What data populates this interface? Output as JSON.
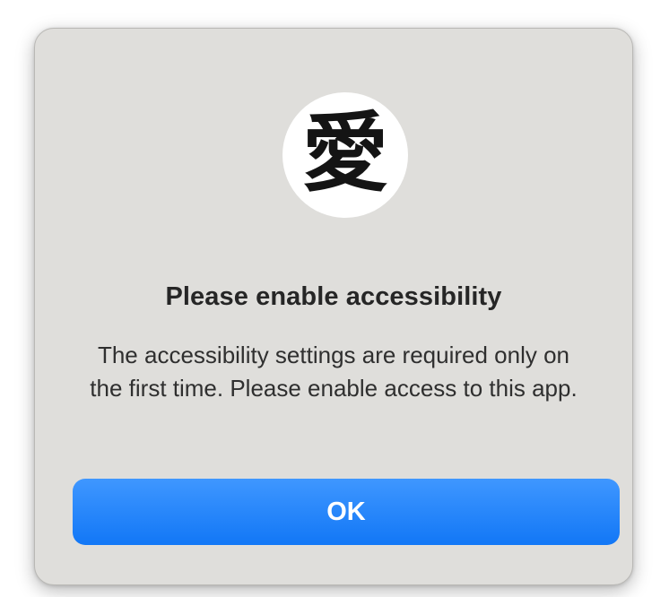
{
  "dialog": {
    "icon": {
      "name": "app-icon-ai-kanji",
      "glyph": "愛"
    },
    "title": "Please enable accessibility",
    "message": "The accessibility settings are required only on the first time. Please enable access to this app.",
    "ok_label": "OK"
  },
  "colors": {
    "dialog_background": "#dfdedb",
    "button_accent": "#1a7ef8",
    "button_text": "#ffffff",
    "title_text": "#262626"
  }
}
